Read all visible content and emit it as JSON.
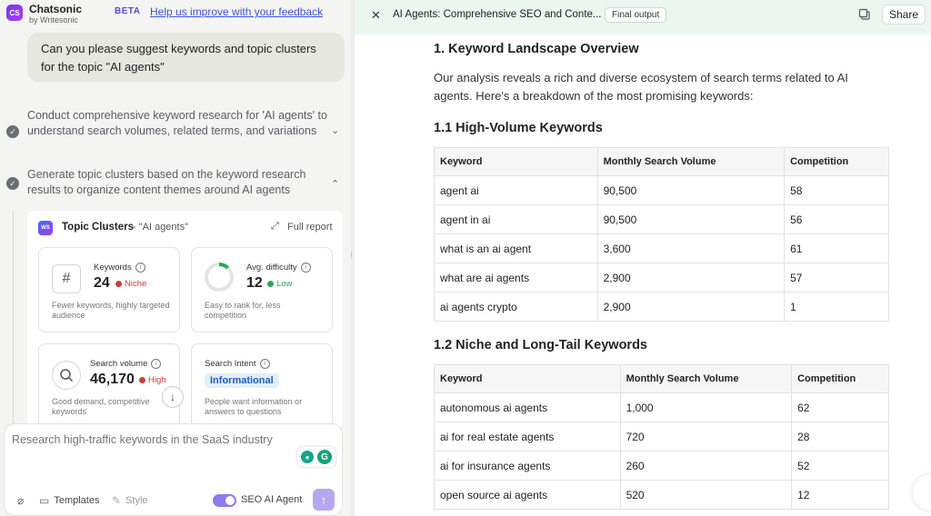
{
  "app": {
    "logo_text": "CS",
    "name": "Chatsonic",
    "byline": "by Writesonic",
    "beta": "BETA",
    "feedback_link": "Help us improve with your feedback"
  },
  "chat": {
    "user_message": "Can you please suggest keywords and topic clusters for the topic \"AI agents\"",
    "steps": [
      {
        "text": "Conduct comprehensive keyword research for 'AI agents' to understand search volumes, related terms, and variations",
        "chevron": "⌄"
      },
      {
        "text": "Generate topic clusters based on the keyword research results to organize content themes around AI agents",
        "chevron": "⌃"
      }
    ]
  },
  "topic_clusters": {
    "logo_text": "WS",
    "title": "Topic Clusters",
    "topic": "- \"AI agents\"",
    "full_report": "Full report",
    "metrics": {
      "keywords": {
        "label": "Keywords",
        "value": "24",
        "badge": "Niche",
        "badge_color": "#d23b3b",
        "desc": "Fewer keywords, highly targeted audience"
      },
      "difficulty": {
        "label": "Avg. difficulty",
        "value": "12",
        "badge": "Low",
        "badge_color": "#2da55b",
        "desc": "Easy to rank for, less competition",
        "level_fraction": 0.12
      },
      "volume": {
        "label": "Search volume",
        "value": "46,170",
        "badge": "High",
        "badge_color": "#d23b3b",
        "desc": "Good demand, competitive keywords"
      },
      "intent": {
        "label": "Search Intent",
        "value": "Informational",
        "desc": "People want information or answers to questions"
      }
    }
  },
  "composer": {
    "placeholder": "Research high-traffic keywords in the SaaS industry",
    "templates": "Templates",
    "style": "Style",
    "seo_agent": "SEO AI Agent"
  },
  "report": {
    "title": "AI Agents: Comprehensive SEO and Conte...",
    "status_pill": "Final output",
    "share": "Share",
    "section1_heading": "1. Keyword Landscape Overview",
    "section1_para": "Our analysis reveals a rich and diverse ecosystem of search terms related to AI agents. Here's a breakdown of the most promising keywords:",
    "section11_heading": "1.1 High-Volume Keywords",
    "section12_heading": "1.2 Niche and Long-Tail Keywords",
    "table_headers": [
      "Keyword",
      "Monthly Search Volume",
      "Competition"
    ],
    "high_volume": [
      [
        "agent ai",
        "90,500",
        "58"
      ],
      [
        "agent in ai",
        "90,500",
        "56"
      ],
      [
        "what is an ai agent",
        "3,600",
        "61"
      ],
      [
        "what are ai agents",
        "2,900",
        "57"
      ],
      [
        "ai agents crypto",
        "2,900",
        "1"
      ]
    ],
    "niche": [
      [
        "autonomous ai agents",
        "1,000",
        "62"
      ],
      [
        "ai for real estate agents",
        "720",
        "28"
      ],
      [
        "ai for insurance agents",
        "260",
        "52"
      ],
      [
        "open source ai agents",
        "520",
        "12"
      ]
    ]
  },
  "colors": {
    "accent": "#6d3bf5",
    "report_bar": "#eaf6ef",
    "link": "#3a55d9"
  }
}
